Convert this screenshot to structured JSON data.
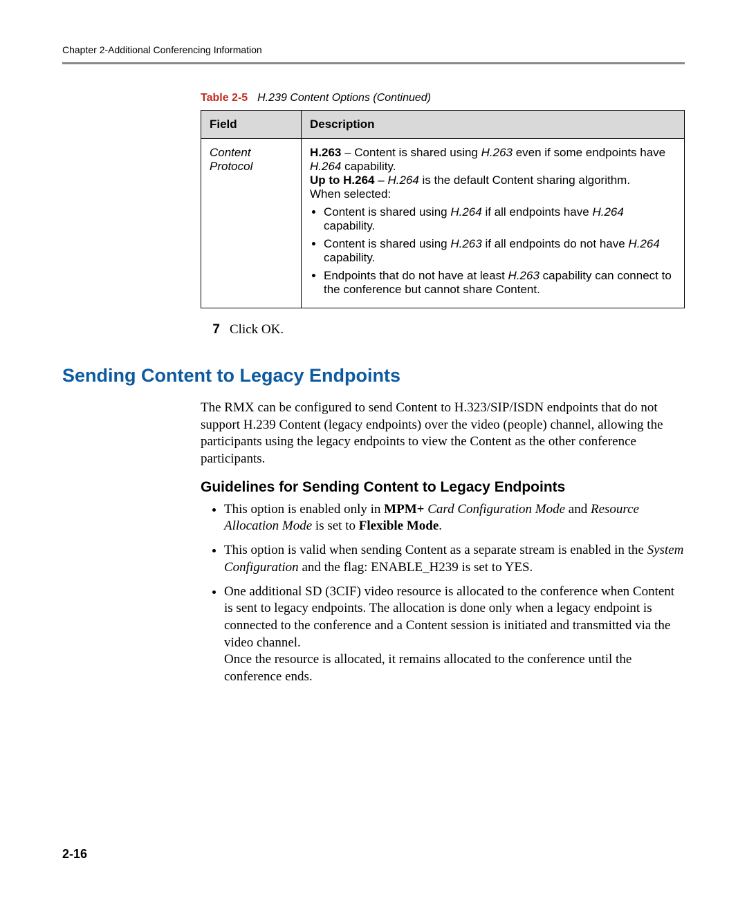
{
  "header": {
    "running_head": "Chapter 2-Additional Conferencing Information"
  },
  "table": {
    "caption_label": "Table 2-5",
    "caption_text": "H.239 Content Options (Continued)",
    "col1": "Field",
    "col2": "Description",
    "row_field": "Content Protocol",
    "desc": {
      "h263_label": "H.263",
      "h263_text_a": " – Content is shared using ",
      "h263_ital": "H.263",
      "h263_text_b": " even if some endpoints have ",
      "h264_ital": "H.264",
      "h263_text_c": " capability.",
      "upto_label": "Up to H.264",
      "upto_text_a": " – ",
      "upto_ital": "H.264",
      "upto_text_b": " is the default Content sharing algorithm.",
      "when_selected": "When selected:",
      "bul1_a": "Content is shared using ",
      "bul1_i": "H.264",
      "bul1_b": " if all endpoints have ",
      "bul1_i2": "H.264",
      "bul1_c": " capability.",
      "bul2_a": "Content is shared using ",
      "bul2_i": "H.263",
      "bul2_b": " if all endpoints do not have ",
      "bul2_i2": "H.264",
      "bul2_c": " capability.",
      "bul3_a": "Endpoints that do not have at least ",
      "bul3_i": "H.263",
      "bul3_b": " capability can connect to the conference but cannot share Content."
    }
  },
  "step": {
    "num": "7",
    "text": "Click OK."
  },
  "section_heading": "Sending Content to Legacy Endpoints",
  "intro_para": "The RMX can be configured to send Content to H.323/SIP/ISDN endpoints that do not support H.239 Content (legacy endpoints) over the video (people) channel, allowing the participants using the legacy endpoints to view the Content as the other conference participants.",
  "subheading": "Guidelines for Sending Content to Legacy Endpoints",
  "guidelines": {
    "g1_a": "This option is enabled only in ",
    "g1_b": "MPM+",
    "g1_c": " Card Configuration Mode",
    "g1_d": " and ",
    "g1_e": "Resource Allocation Mode",
    "g1_f": " is set to ",
    "g1_g": "Flexible Mode",
    "g1_h": ".",
    "g2_a": "This option is valid when sending Content as a separate stream is enabled in the ",
    "g2_b": "System Configuration",
    "g2_c": " and the flag: ENABLE_H239 is set to YES.",
    "g3_a": "One additional SD (3CIF) video resource is allocated to the conference when Content is sent to legacy endpoints. The allocation is done only when a legacy endpoint is connected to the conference and a Content session is initiated and transmitted via the video channel.",
    "g3_b": "Once the resource is allocated, it remains allocated to the conference until the conference ends."
  },
  "page_number": "2-16"
}
